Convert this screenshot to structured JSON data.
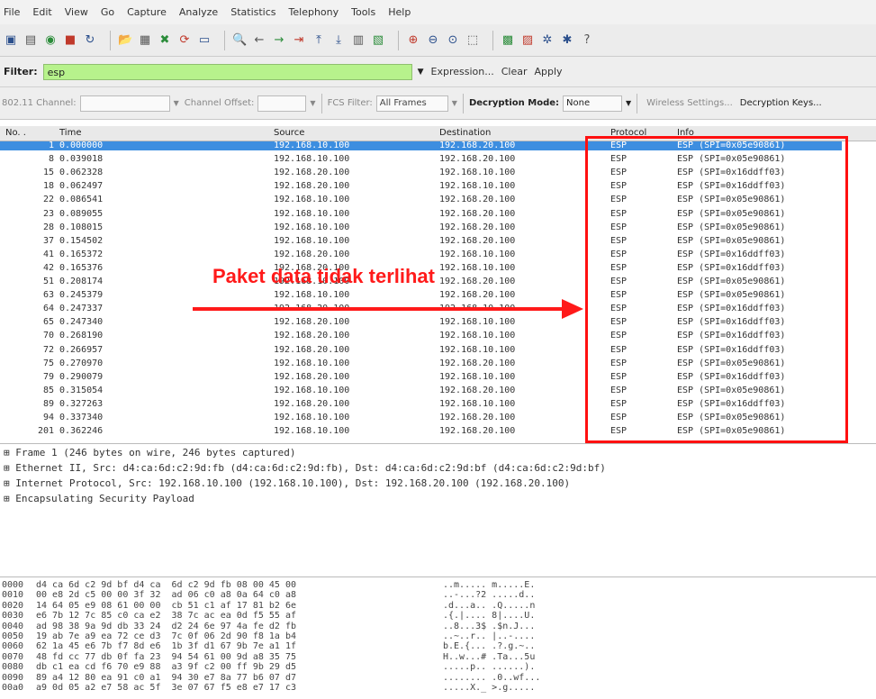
{
  "menu": [
    "File",
    "Edit",
    "View",
    "Go",
    "Capture",
    "Analyze",
    "Statistics",
    "Telephony",
    "Tools",
    "Help"
  ],
  "toolbar_icons": [
    "interfaces-icon",
    "options-icon",
    "start-icon",
    "stop-icon",
    "restart-icon",
    "open-icon",
    "save-icon",
    "close-icon",
    "reload-icon",
    "print-icon",
    "find-icon",
    "back-icon",
    "forward-icon",
    "goto-icon",
    "top-icon",
    "bottom-icon",
    "colorize-icon",
    "autoscroll-icon",
    "zoom-in-icon",
    "zoom-out-icon",
    "zoom-normal-icon",
    "resize-columns-icon",
    "capture-filters-icon",
    "display-filters-icon",
    "coloring-rules-icon",
    "preferences-icon",
    "help-icon"
  ],
  "filter": {
    "label": "Filter:",
    "value": "esp",
    "expression": "Expression...",
    "clear": "Clear",
    "apply": "Apply"
  },
  "wireless": {
    "channel_label": "802.11 Channel:",
    "offset_label": "Channel Offset:",
    "fcs_label": "FCS Filter:",
    "fcs_value": "All Frames",
    "decryption_label": "Decryption Mode:",
    "decryption_value": "None",
    "wireless_settings": "Wireless Settings...",
    "decryption_keys": "Decryption Keys..."
  },
  "columns": [
    "No. .",
    "Time",
    "Source",
    "Destination",
    "Protocol",
    "Info"
  ],
  "packets": [
    {
      "no": "1",
      "time": "0.000000",
      "src": "192.168.10.100",
      "dst": "192.168.20.100",
      "proto": "ESP",
      "info": "ESP (SPI=0x05e90861)"
    },
    {
      "no": "8",
      "time": "0.039018",
      "src": "192.168.10.100",
      "dst": "192.168.20.100",
      "proto": "ESP",
      "info": "ESP (SPI=0x05e90861)"
    },
    {
      "no": "15",
      "time": "0.062328",
      "src": "192.168.20.100",
      "dst": "192.168.10.100",
      "proto": "ESP",
      "info": "ESP (SPI=0x16ddff03)"
    },
    {
      "no": "18",
      "time": "0.062497",
      "src": "192.168.20.100",
      "dst": "192.168.10.100",
      "proto": "ESP",
      "info": "ESP (SPI=0x16ddff03)"
    },
    {
      "no": "22",
      "time": "0.086541",
      "src": "192.168.10.100",
      "dst": "192.168.20.100",
      "proto": "ESP",
      "info": "ESP (SPI=0x05e90861)"
    },
    {
      "no": "23",
      "time": "0.089055",
      "src": "192.168.10.100",
      "dst": "192.168.20.100",
      "proto": "ESP",
      "info": "ESP (SPI=0x05e90861)"
    },
    {
      "no": "28",
      "time": "0.108015",
      "src": "192.168.10.100",
      "dst": "192.168.20.100",
      "proto": "ESP",
      "info": "ESP (SPI=0x05e90861)"
    },
    {
      "no": "37",
      "time": "0.154502",
      "src": "192.168.10.100",
      "dst": "192.168.20.100",
      "proto": "ESP",
      "info": "ESP (SPI=0x05e90861)"
    },
    {
      "no": "41",
      "time": "0.165372",
      "src": "192.168.20.100",
      "dst": "192.168.10.100",
      "proto": "ESP",
      "info": "ESP (SPI=0x16ddff03)"
    },
    {
      "no": "42",
      "time": "0.165376",
      "src": "192.168.20.100",
      "dst": "192.168.10.100",
      "proto": "ESP",
      "info": "ESP (SPI=0x16ddff03)"
    },
    {
      "no": "51",
      "time": "0.208174",
      "src": "192.168.10.100",
      "dst": "192.168.20.100",
      "proto": "ESP",
      "info": "ESP (SPI=0x05e90861)"
    },
    {
      "no": "63",
      "time": "0.245379",
      "src": "192.168.10.100",
      "dst": "192.168.20.100",
      "proto": "ESP",
      "info": "ESP (SPI=0x05e90861)"
    },
    {
      "no": "64",
      "time": "0.247337",
      "src": "192.168.20.100",
      "dst": "192.168.10.100",
      "proto": "ESP",
      "info": "ESP (SPI=0x16ddff03)"
    },
    {
      "no": "65",
      "time": "0.247340",
      "src": "192.168.20.100",
      "dst": "192.168.10.100",
      "proto": "ESP",
      "info": "ESP (SPI=0x16ddff03)"
    },
    {
      "no": "70",
      "time": "0.268190",
      "src": "192.168.20.100",
      "dst": "192.168.10.100",
      "proto": "ESP",
      "info": "ESP (SPI=0x16ddff03)"
    },
    {
      "no": "72",
      "time": "0.266957",
      "src": "192.168.20.100",
      "dst": "192.168.10.100",
      "proto": "ESP",
      "info": "ESP (SPI=0x16ddff03)"
    },
    {
      "no": "75",
      "time": "0.270970",
      "src": "192.168.10.100",
      "dst": "192.168.20.100",
      "proto": "ESP",
      "info": "ESP (SPI=0x05e90861)"
    },
    {
      "no": "79",
      "time": "0.290079",
      "src": "192.168.20.100",
      "dst": "192.168.10.100",
      "proto": "ESP",
      "info": "ESP (SPI=0x16ddff03)"
    },
    {
      "no": "85",
      "time": "0.315054",
      "src": "192.168.10.100",
      "dst": "192.168.20.100",
      "proto": "ESP",
      "info": "ESP (SPI=0x05e90861)"
    },
    {
      "no": "89",
      "time": "0.327263",
      "src": "192.168.20.100",
      "dst": "192.168.10.100",
      "proto": "ESP",
      "info": "ESP (SPI=0x16ddff03)"
    },
    {
      "no": "94",
      "time": "0.337340",
      "src": "192.168.10.100",
      "dst": "192.168.20.100",
      "proto": "ESP",
      "info": "ESP (SPI=0x05e90861)"
    },
    {
      "no": "201",
      "time": "0.362246",
      "src": "192.168.10.100",
      "dst": "192.168.20.100",
      "proto": "ESP",
      "info": "ESP (SPI=0x05e90861)"
    }
  ],
  "details": [
    "Frame 1 (246 bytes on wire, 246 bytes captured)",
    "Ethernet II, Src: d4:ca:6d:c2:9d:fb (d4:ca:6d:c2:9d:fb), Dst: d4:ca:6d:c2:9d:bf (d4:ca:6d:c2:9d:bf)",
    "Internet Protocol, Src: 192.168.10.100 (192.168.10.100), Dst: 192.168.20.100 (192.168.20.100)",
    "Encapsulating Security Payload"
  ],
  "hex": [
    {
      "off": "0000",
      "bytes": "d4 ca 6d c2 9d bf d4 ca  6d c2 9d fb 08 00 45 00",
      "ascii": "..m..... m.....E."
    },
    {
      "off": "0010",
      "bytes": "00 e8 2d c5 00 00 3f 32  ad 06 c0 a8 0a 64 c0 a8",
      "ascii": "..-...?2 .....d.."
    },
    {
      "off": "0020",
      "bytes": "14 64 05 e9 08 61 00 00  cb 51 c1 af 17 81 b2 6e",
      "ascii": ".d...a.. .Q.....n"
    },
    {
      "off": "0030",
      "bytes": "e6 7b 12 7c 85 c0 ca e2  38 7c ac ea 0d f5 55 af",
      "ascii": ".{.|.... 8|....U."
    },
    {
      "off": "0040",
      "bytes": "ad 98 38 9a 9d db 33 24  d2 24 6e 97 4a fe d2 fb",
      "ascii": "..8...3$ .$n.J..."
    },
    {
      "off": "0050",
      "bytes": "19 ab 7e a9 ea 72 ce d3  7c 0f 06 2d 90 f8 1a b4",
      "ascii": "..~..r.. |..-...."
    },
    {
      "off": "0060",
      "bytes": "62 1a 45 e6 7b f7 8d e6  1b 3f d1 67 9b 7e a1 1f",
      "ascii": "b.E.{... .?.g.~.."
    },
    {
      "off": "0070",
      "bytes": "48 fd cc 77 db 0f fa 23  94 54 61 00 9d a8 35 75",
      "ascii": "H..w...# .Ta...5u"
    },
    {
      "off": "0080",
      "bytes": "db c1 ea cd f6 70 e9 88  a3 9f c2 00 ff 9b 29 d5",
      "ascii": ".....p.. ......)."
    },
    {
      "off": "0090",
      "bytes": "89 a4 12 80 ea 91 c0 a1  94 30 e7 8a 77 b6 07 d7",
      "ascii": "........ .0..wf..."
    },
    {
      "off": "00a0",
      "bytes": "a9 0d 05 a2 e7 58 ac 5f  3e 07 67 f5 e8 e7 17 c3",
      "ascii": ".....X._ >.g....."
    }
  ],
  "annotation": "Paket data tidak terlihat",
  "colors": {
    "selected_row": "#3d8ee0",
    "highlight_box": "#ff1010",
    "filter_bg": "#b7f28c"
  }
}
